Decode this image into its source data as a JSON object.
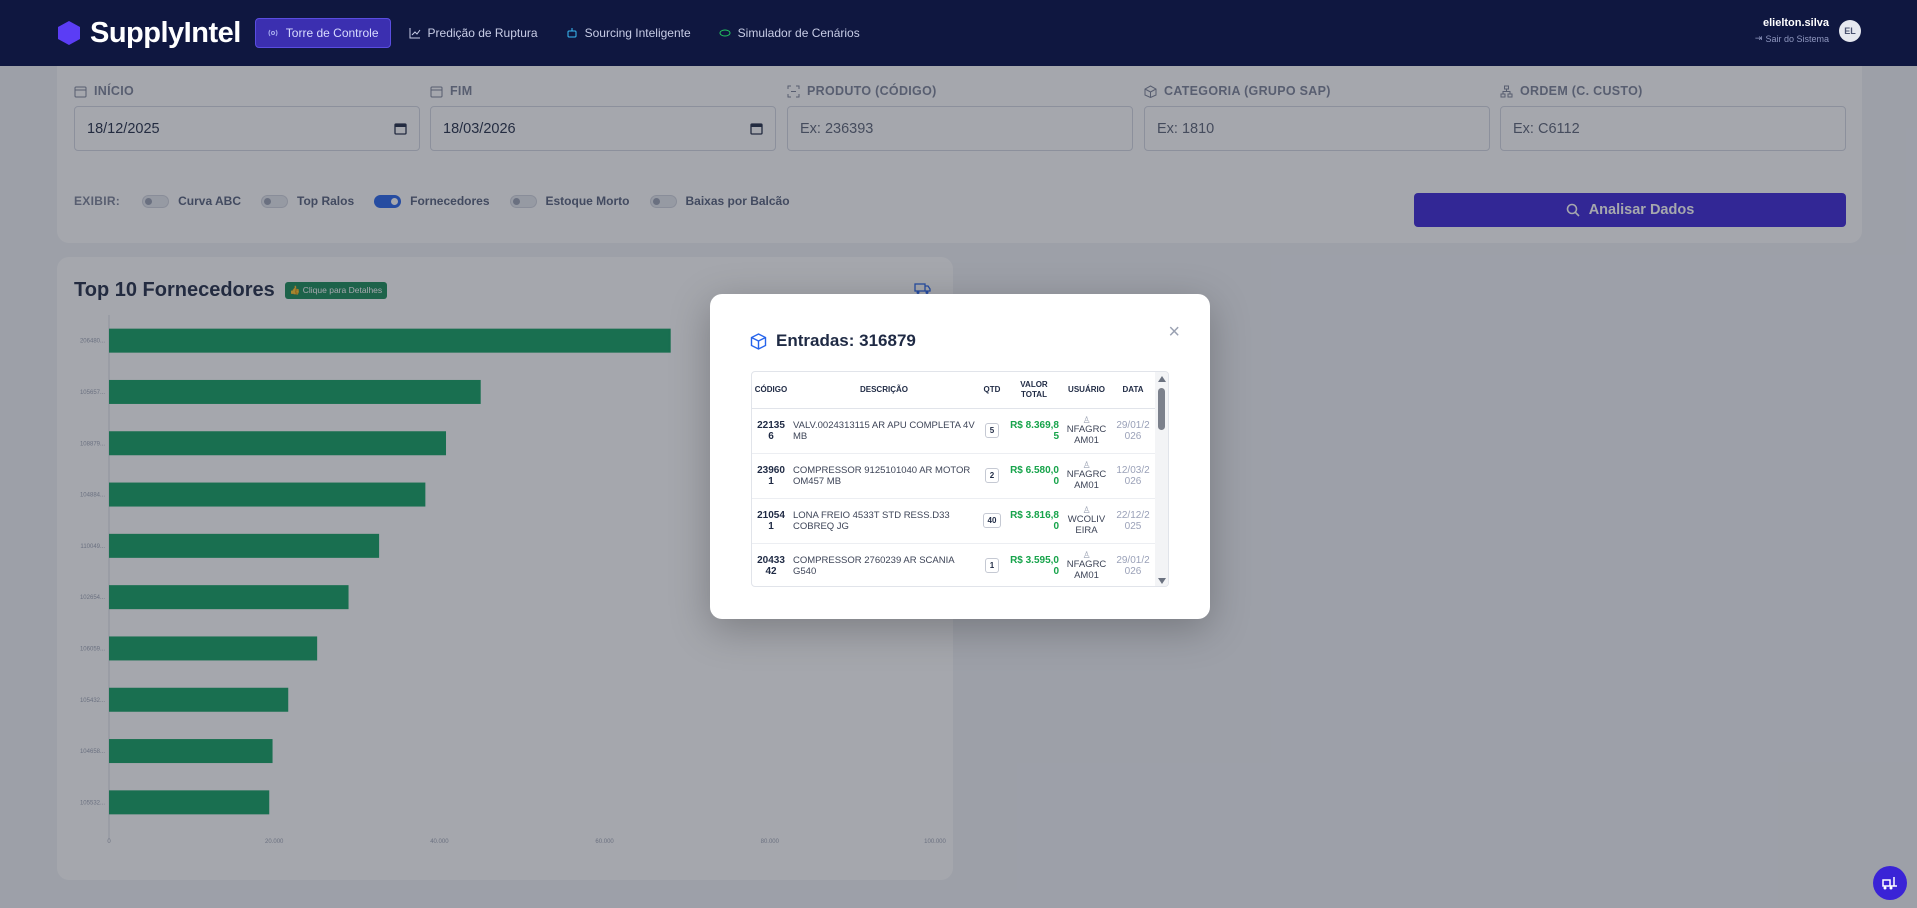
{
  "app": {
    "brand": "SupplyIntel",
    "nav": [
      {
        "label": "Torre de Controle",
        "active": true,
        "icon": "radio-tower-icon"
      },
      {
        "label": "Predição de Ruptura",
        "active": false,
        "icon": "trend-chart-icon"
      },
      {
        "label": "Sourcing Inteligente",
        "active": false,
        "icon": "robot-icon"
      },
      {
        "label": "Simulador de Cenários",
        "active": false,
        "icon": "orbit-icon"
      }
    ],
    "user": {
      "name": "elielton.silva",
      "logout": "Sair do Sistema",
      "initials": "EL"
    }
  },
  "filters": {
    "inicio": {
      "label": "INÍCIO",
      "value": "18/12/2025"
    },
    "fim": {
      "label": "FIM",
      "value": "18/03/2026"
    },
    "produto": {
      "label": "PRODUTO (CÓDIGO)",
      "placeholder": "Ex: 236393"
    },
    "categoria": {
      "label": "CATEGORIA (GRUPO SAP)",
      "placeholder": "Ex: 1810"
    },
    "ordem": {
      "label": "ORDEM (C. CUSTO)",
      "placeholder": "Ex: C6112"
    },
    "show_label": "EXIBIR:",
    "toggles": [
      {
        "label": "Curva ABC",
        "on": false
      },
      {
        "label": "Top Ralos",
        "on": false
      },
      {
        "label": "Fornecedores",
        "on": true
      },
      {
        "label": "Estoque Morto",
        "on": false
      },
      {
        "label": "Baixas por Balcão",
        "on": false
      }
    ],
    "analyze_label": "Analisar Dados"
  },
  "chart_card": {
    "title": "Top 10 Fornecedores",
    "badge": "Clique para Detalhes"
  },
  "chart_data": {
    "type": "bar",
    "orientation": "horizontal",
    "title": "Top 10 Fornecedores",
    "categories": [
      "206480...",
      "105657...",
      "108879...",
      "104884...",
      "110049...",
      "102654...",
      "106059...",
      "105432...",
      "104658...",
      "105532..."
    ],
    "values": [
      68000,
      45000,
      40800,
      38300,
      32700,
      29000,
      25200,
      21700,
      19800,
      19400
    ],
    "xlim": [
      0,
      100000
    ],
    "xticks": [
      "0",
      "20.000",
      "40.000",
      "60.000",
      "80.000",
      "100.000"
    ],
    "bar_color": "#0f9f5f",
    "grid": false
  },
  "modal": {
    "title": "Entradas: 316879",
    "close": "×",
    "columns": [
      "CÓDIGO",
      "DESCRIÇÃO",
      "QTD",
      "VALOR TOTAL",
      "USUÁRIO",
      "DATA"
    ],
    "rows": [
      {
        "code": "221356",
        "desc": "VALV.0024313115 AR APU COMPLETA 4V MB",
        "qty": "5",
        "value": "R$ 8.369,85",
        "user": "NFAGRCAM01",
        "date": "29/01/2026"
      },
      {
        "code": "239601",
        "desc": "COMPRESSOR 9125101040 AR MOTOR OM457 MB",
        "qty": "2",
        "value": "R$ 6.580,00",
        "user": "NFAGRCAM01",
        "date": "12/03/2026"
      },
      {
        "code": "210541",
        "desc": "LONA FREIO 4533T STD RESS.D33 COBREQ JG",
        "qty": "40",
        "value": "R$ 3.816,80",
        "user": "WCOLIVEIRA",
        "date": "22/12/2025"
      },
      {
        "code": "2043342",
        "desc": "COMPRESSOR 2760239 AR SCANIA G540",
        "qty": "1",
        "value": "R$ 3.595,00",
        "user": "NFAGRCAM01",
        "date": "29/01/2026"
      }
    ]
  },
  "colors": {
    "nav_bg": "#0f1740",
    "accent": "#3a23d6",
    "bar": "#0f9f5f",
    "value_green": "#16a34a"
  }
}
